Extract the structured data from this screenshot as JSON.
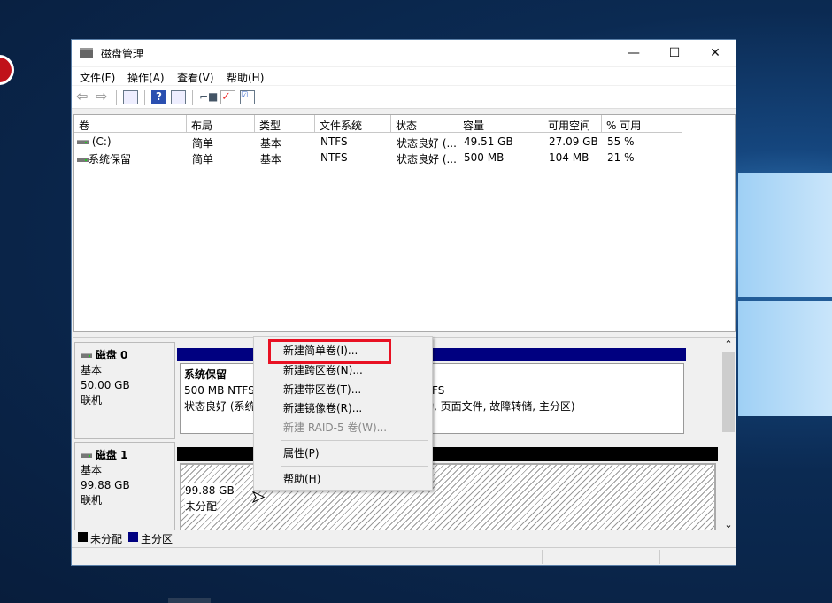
{
  "window": {
    "title": "磁盘管理",
    "minimize": "—",
    "maximize": "☐",
    "close": "✕"
  },
  "menu": [
    "文件(F)",
    "操作(A)",
    "查看(V)",
    "帮助(H)"
  ],
  "toolbar": [
    "back-icon",
    "forward-icon",
    "console-tree-icon",
    "help-icon",
    "action-pane-icon",
    "connect-icon",
    "check-icon",
    "properties-icon"
  ],
  "columns": [
    "卷",
    "布局",
    "类型",
    "文件系统",
    "状态",
    "容量",
    "可用空间",
    "% 可用"
  ],
  "rows": [
    [
      "(C:)",
      "简单",
      "基本",
      "NTFS",
      "状态良好 (...",
      "49.51 GB",
      "27.09 GB",
      "55 %"
    ],
    [
      "系统保留",
      "简单",
      "基本",
      "NTFS",
      "状态良好 (...",
      "500 MB",
      "104 MB",
      "21 %"
    ]
  ],
  "disks": [
    {
      "name": "磁盘 0",
      "type": "基本",
      "size": "50.00 GB",
      "status": "联机",
      "partitions": [
        {
          "name": "系统保留",
          "info": "500 MB NTFS",
          "status": "状态良好 (系统"
        },
        {
          "info": "FS",
          "status": "动, 页面文件, 故障转储, 主分区)"
        }
      ]
    },
    {
      "name": "磁盘 1",
      "type": "基本",
      "size": "99.88 GB",
      "status": "联机",
      "partitions": [
        {
          "info": "99.88 GB",
          "status": "未分配"
        }
      ]
    }
  ],
  "legend": [
    {
      "label": "未分配",
      "color": "#000000"
    },
    {
      "label": "主分区",
      "color": "#000080"
    }
  ],
  "context_menu": {
    "items": [
      "新建简单卷(I)...",
      "新建跨区卷(N)...",
      "新建带区卷(T)...",
      "新建镜像卷(R)...",
      "新建 RAID-5 卷(W)...",
      "属性(P)",
      "帮助(H)"
    ],
    "highlight_color": "#e81123"
  },
  "scroll": {
    "up": "⌃",
    "down": "⌄"
  }
}
